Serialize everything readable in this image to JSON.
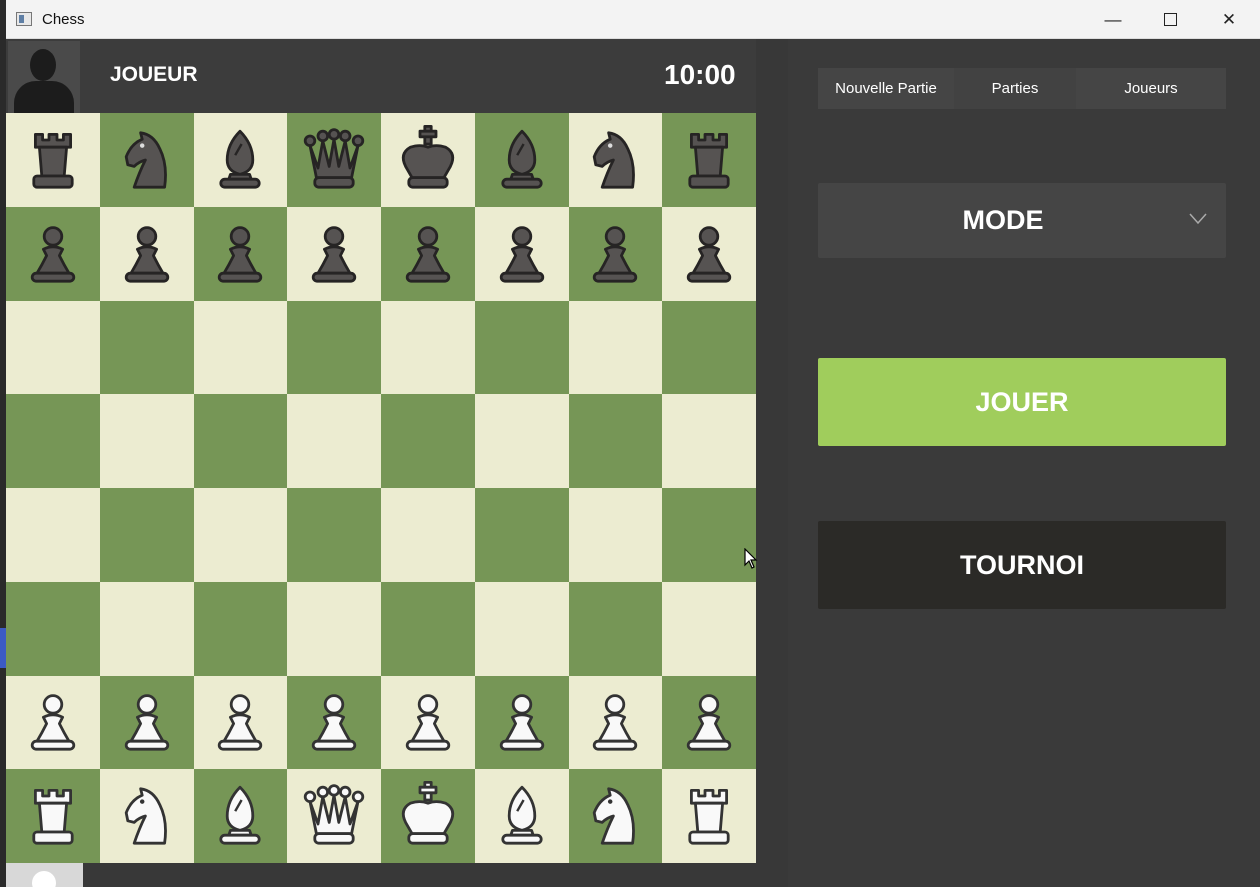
{
  "window": {
    "title": "Chess",
    "controls": {
      "minimize": "—",
      "close": "✕"
    }
  },
  "player": {
    "name": "JOUEUR",
    "clock": "10:00"
  },
  "board": {
    "light_color": "#ececd1",
    "dark_color": "#769656",
    "ranks": [
      [
        "br",
        "bn",
        "bb",
        "bq",
        "bk",
        "bb",
        "bn",
        "br"
      ],
      [
        "bp",
        "bp",
        "bp",
        "bp",
        "bp",
        "bp",
        "bp",
        "bp"
      ],
      [
        "",
        "",
        "",
        "",
        "",
        "",
        "",
        ""
      ],
      [
        "",
        "",
        "",
        "",
        "",
        "",
        "",
        ""
      ],
      [
        "",
        "",
        "",
        "",
        "",
        "",
        "",
        ""
      ],
      [
        "",
        "",
        "",
        "",
        "",
        "",
        "",
        ""
      ],
      [
        "wp",
        "wp",
        "wp",
        "wp",
        "wp",
        "wp",
        "wp",
        "wp"
      ],
      [
        "wr",
        "wn",
        "wb",
        "wq",
        "wk",
        "wb",
        "wn",
        "wr"
      ]
    ],
    "piece_names": {
      "k": "king",
      "q": "queen",
      "r": "rook",
      "b": "bishop",
      "n": "knight",
      "p": "pawn"
    }
  },
  "menu": {
    "tabs": [
      {
        "label": "Nouvelle Partie"
      },
      {
        "label": "Parties"
      },
      {
        "label": "Joueurs"
      }
    ],
    "mode_label": "MODE",
    "play_label": "JOUER",
    "tournament_label": "TOURNOI",
    "accent_color": "#a0cd5c"
  }
}
